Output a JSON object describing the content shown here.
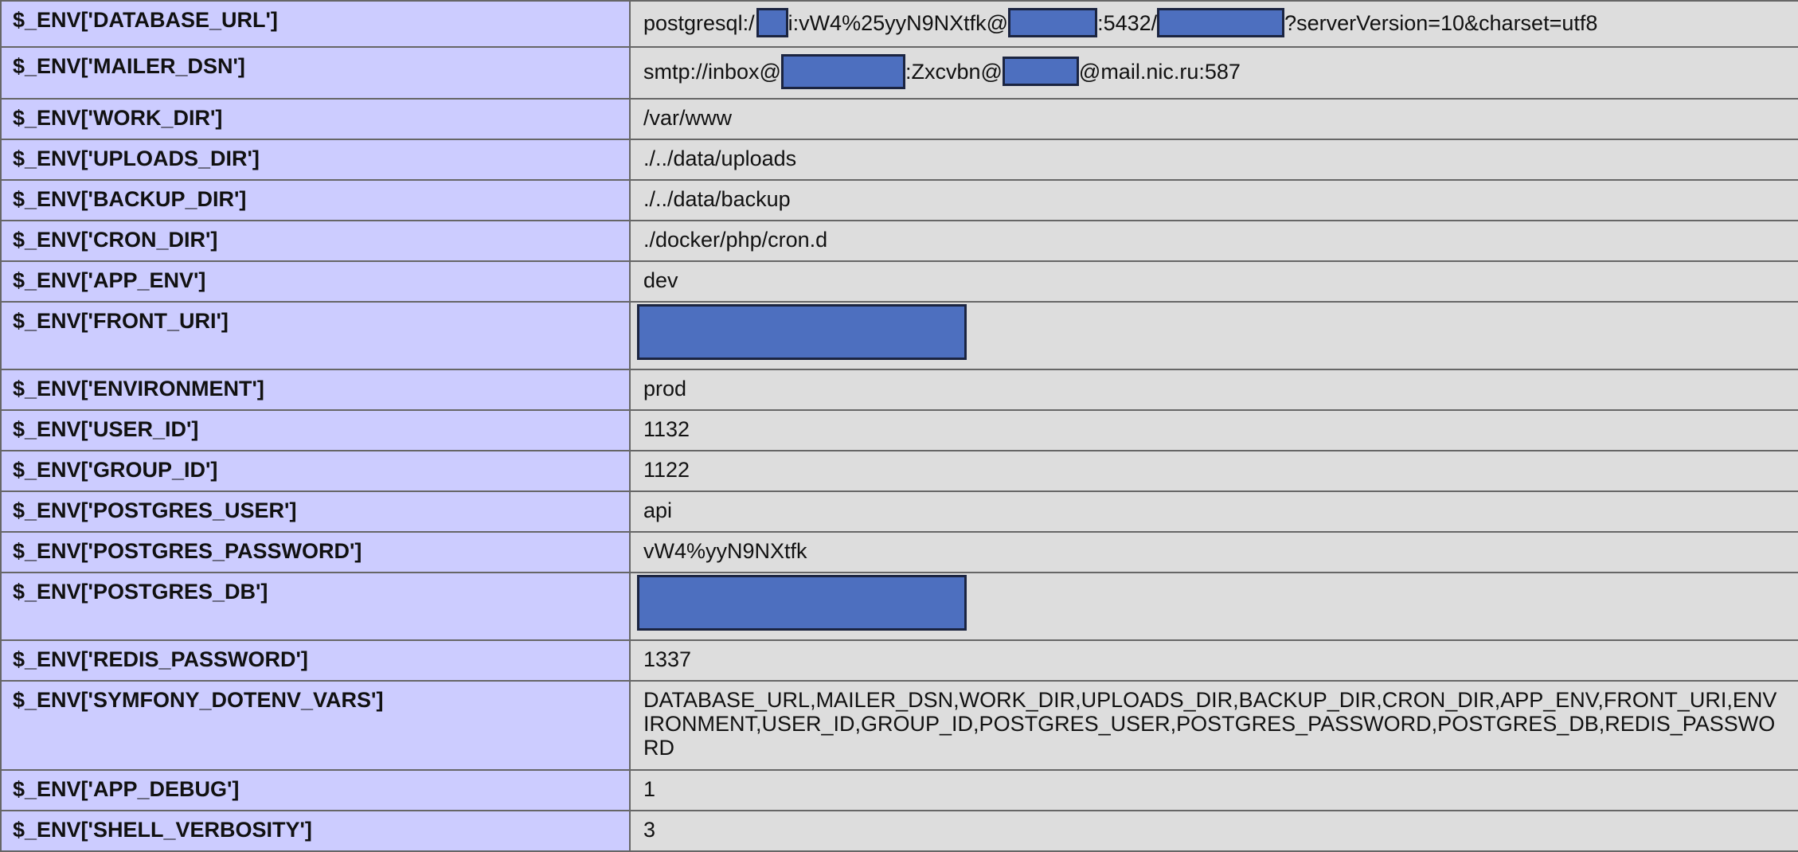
{
  "rows": [
    {
      "key": "$_ENV['DATABASE_URL']",
      "value_parts": [
        "postgresql:/",
        "i:vW4%25yyN9NXtfk@",
        ":5432/",
        "?serverVersion=10&charset=utf8"
      ]
    },
    {
      "key": "$_ENV['MAILER_DSN']",
      "value_parts": [
        "smtp://inbox@",
        ":Zxcvbn@",
        "@mail.nic.ru:587"
      ]
    },
    {
      "key": "$_ENV['WORK_DIR']",
      "value": "/var/www"
    },
    {
      "key": "$_ENV['UPLOADS_DIR']",
      "value": "./../data/uploads"
    },
    {
      "key": "$_ENV['BACKUP_DIR']",
      "value": "./../data/backup"
    },
    {
      "key": "$_ENV['CRON_DIR']",
      "value": "./docker/php/cron.d"
    },
    {
      "key": "$_ENV['APP_ENV']",
      "value": "dev"
    },
    {
      "key": "$_ENV['FRONT_URI']",
      "value": ""
    },
    {
      "key": "$_ENV['ENVIRONMENT']",
      "value": "prod"
    },
    {
      "key": "$_ENV['USER_ID']",
      "value": "1132"
    },
    {
      "key": "$_ENV['GROUP_ID']",
      "value": "1122"
    },
    {
      "key": "$_ENV['POSTGRES_USER']",
      "value": "api"
    },
    {
      "key": "$_ENV['POSTGRES_PASSWORD']",
      "value": "vW4%yyN9NXtfk"
    },
    {
      "key": "$_ENV['POSTGRES_DB']",
      "value": ""
    },
    {
      "key": "$_ENV['REDIS_PASSWORD']",
      "value": "1337"
    },
    {
      "key": "$_ENV['SYMFONY_DOTENV_VARS']",
      "value": "DATABASE_URL,MAILER_DSN,WORK_DIR,UPLOADS_DIR,BACKUP_DIR,CRON_DIR,APP_ENV,FRONT_URI,ENVIRONMENT,USER_ID,GROUP_ID,POSTGRES_USER,POSTGRES_PASSWORD,POSTGRES_DB,REDIS_PASSWORD"
    },
    {
      "key": "$_ENV['APP_DEBUG']",
      "value": "1"
    },
    {
      "key": "$_ENV['SHELL_VERBOSITY']",
      "value": "3"
    }
  ],
  "colors": {
    "key_bg": "#ccccff",
    "value_bg": "#dddddd",
    "border": "#666666",
    "redaction": "#4d6fbf"
  }
}
